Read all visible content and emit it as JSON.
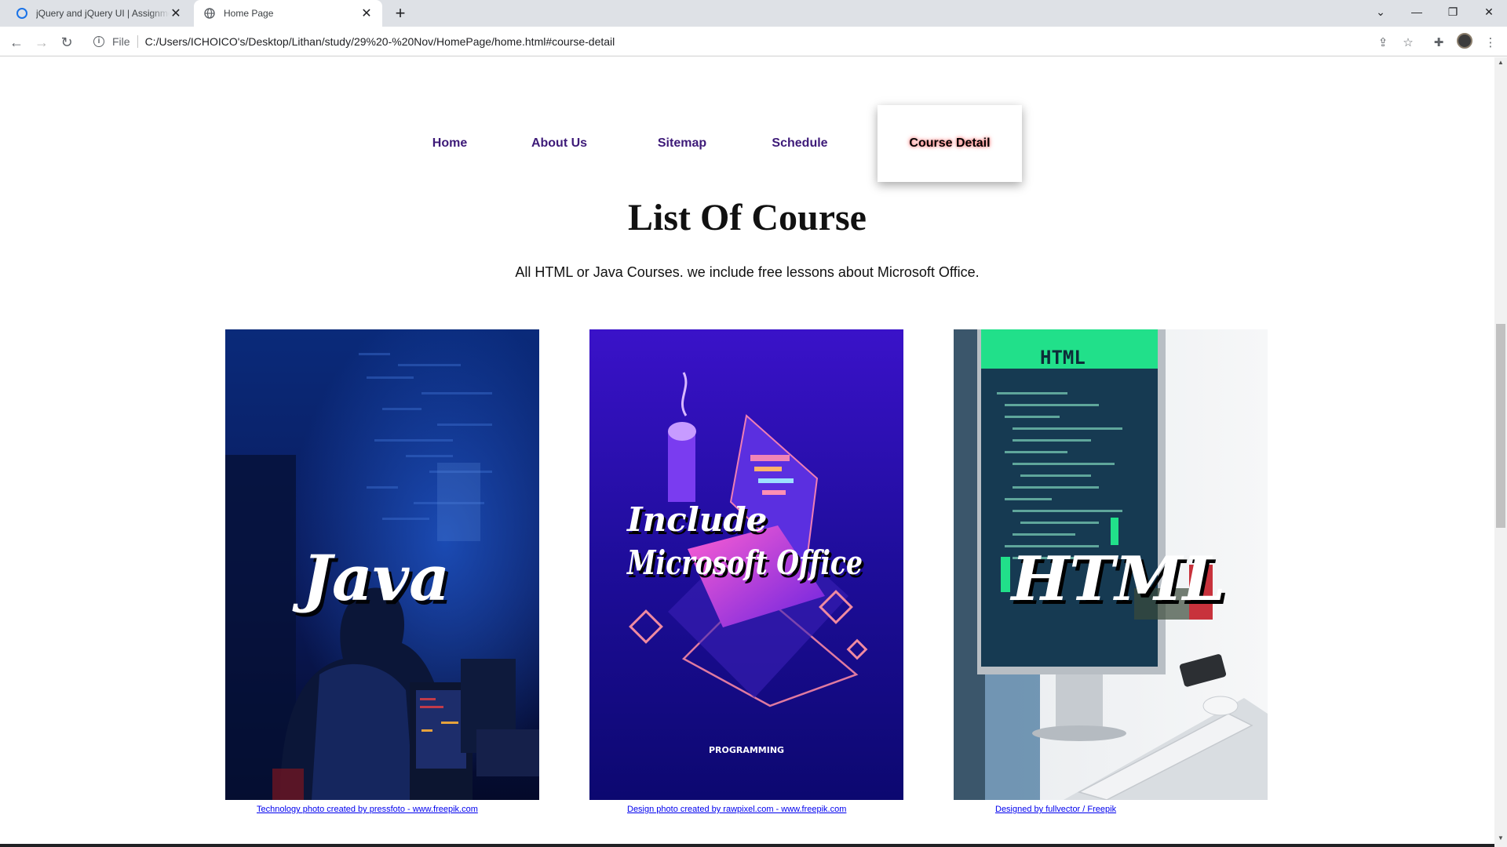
{
  "browser": {
    "tabs": [
      {
        "title": "jQuery and jQuery UI | Assignment",
        "active": false
      },
      {
        "title": "Home Page",
        "active": true
      }
    ],
    "address": {
      "scheme_label": "File",
      "url": "C:/Users/ICHOICO's/Desktop/Lithan/study/29%20-%20Nov/HomePage/home.html#course-detail"
    }
  },
  "nav": {
    "items": [
      {
        "label": "Home",
        "active": false
      },
      {
        "label": "About Us",
        "active": false
      },
      {
        "label": "Sitemap",
        "active": false
      },
      {
        "label": "Schedule",
        "active": false
      },
      {
        "label": "Course Detail",
        "active": true
      }
    ]
  },
  "main": {
    "heading": "List Of Course",
    "subtitle": "All HTML or Java Courses. we include free lessons about Microsoft Office."
  },
  "courses": [
    {
      "image_text": "Java",
      "credit": "Technology photo created by pressfoto - www.freepik.com"
    },
    {
      "image_text_line1": "Include",
      "image_text_line2": "Microsoft Office",
      "image_small_text": "PROGRAMMING",
      "credit": "Design photo created by rawpixel.com - www.freepik.com"
    },
    {
      "image_text": "HTML",
      "image_screen_text": "HTML",
      "credit": "Designed by fullvector / Freepik"
    }
  ],
  "colors": {
    "nav_link": "#3d1a78",
    "link": "#0000ee",
    "chrome_bg": "#dee1e6"
  }
}
